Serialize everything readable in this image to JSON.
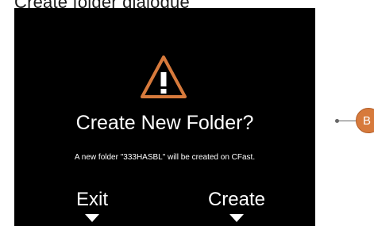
{
  "caption": "Create folder dialogue",
  "dialog": {
    "icon": "warning-icon",
    "title": "Create New Folder?",
    "message": "A new folder \"333HASBL\" will be created on CFast.",
    "softkeys": [
      {
        "label": "Exit"
      },
      {
        "label": "Create"
      }
    ]
  },
  "callout": {
    "label": "B"
  },
  "colors": {
    "screen_background": "#000000",
    "text": "#ffffff",
    "accent": "#d77a3c"
  }
}
